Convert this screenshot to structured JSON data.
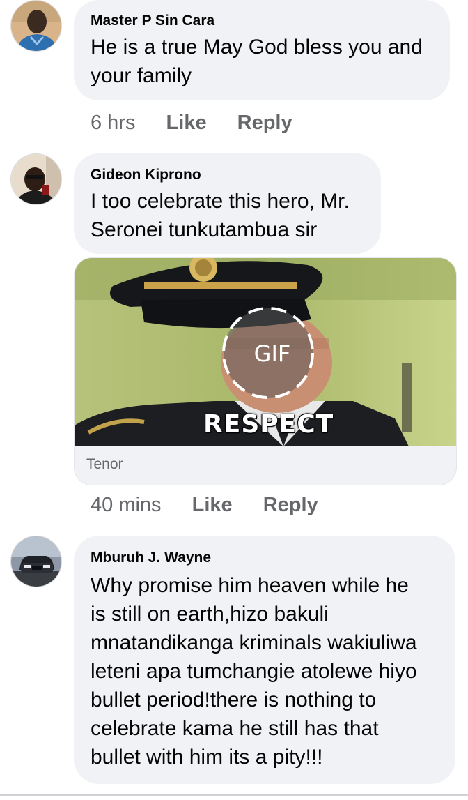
{
  "comments": [
    {
      "author": "Master P Sin Cara",
      "text_lines": [
        "He is a true May God bless you and",
        "your family"
      ],
      "time": "6 hrs",
      "like_label": "Like",
      "reply_label": "Reply"
    },
    {
      "author": "Gideon Kiprono",
      "text_lines": [
        "I too celebrate this hero, Mr.",
        "Seronei tunkutambua sir"
      ],
      "time": "40 mins",
      "like_label": "Like",
      "reply_label": "Reply",
      "gif": {
        "badge": "GIF",
        "caption": "RESPECT",
        "source": "Tenor"
      }
    },
    {
      "author": "Mburuh J. Wayne",
      "text_lines": [
        "Why promise him heaven while he",
        "is still on earth,hizo bakuli",
        "mnatandikanga kriminals wakiuliwa",
        "leteni apa tumchangie atolewe hiyo",
        "bullet period!there is nothing to",
        "celebrate kama he still has that",
        "bullet with him its a pity!!!"
      ]
    }
  ],
  "colors": {
    "bubble": "#f0f2f5",
    "meta_text": "#65676b",
    "primary_text": "#050505"
  }
}
